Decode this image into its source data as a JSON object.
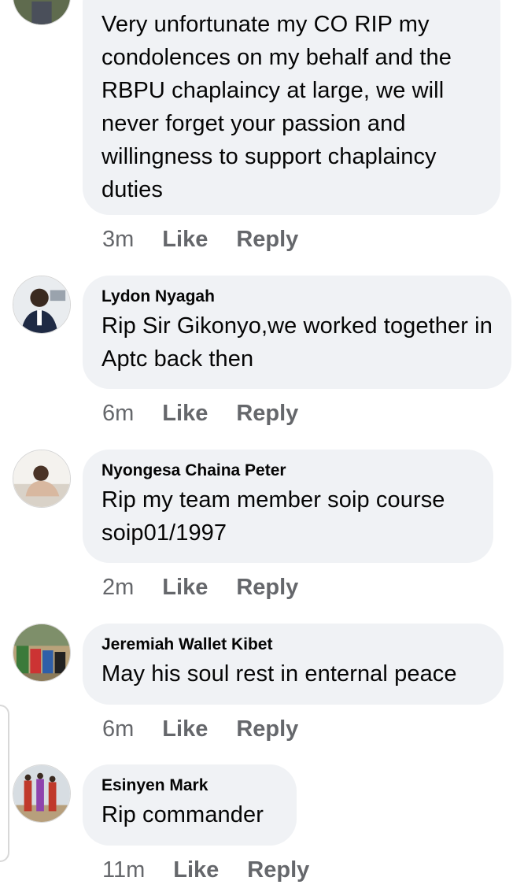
{
  "comments": [
    {
      "author": "",
      "text": "Very unfortunate my CO RIP my condolences on my behalf and the RBPU chaplaincy at large, we will never forget your passion and willingness to support chaplaincy duties",
      "time": "3m",
      "like": "Like",
      "reply": "Reply"
    },
    {
      "author": "Lydon Nyagah",
      "text": "Rip Sir Gikonyo,we worked together in Aptc back then",
      "time": "6m",
      "like": "Like",
      "reply": "Reply"
    },
    {
      "author": "Nyongesa Chaina Peter",
      "text": "Rip my team member soip course soip01/1997",
      "time": "2m",
      "like": "Like",
      "reply": "Reply"
    },
    {
      "author": "Jeremiah Wallet Kibet",
      "text": "May his soul rest in enternal peace",
      "time": "6m",
      "like": "Like",
      "reply": "Reply"
    },
    {
      "author": "Esinyen Mark",
      "text": "Rip commander",
      "time": "11m",
      "like": "Like",
      "reply": "Reply"
    }
  ],
  "colors": {
    "bubble": "#f0f2f5",
    "meta_text": "#65676b",
    "body_text": "#050505"
  }
}
